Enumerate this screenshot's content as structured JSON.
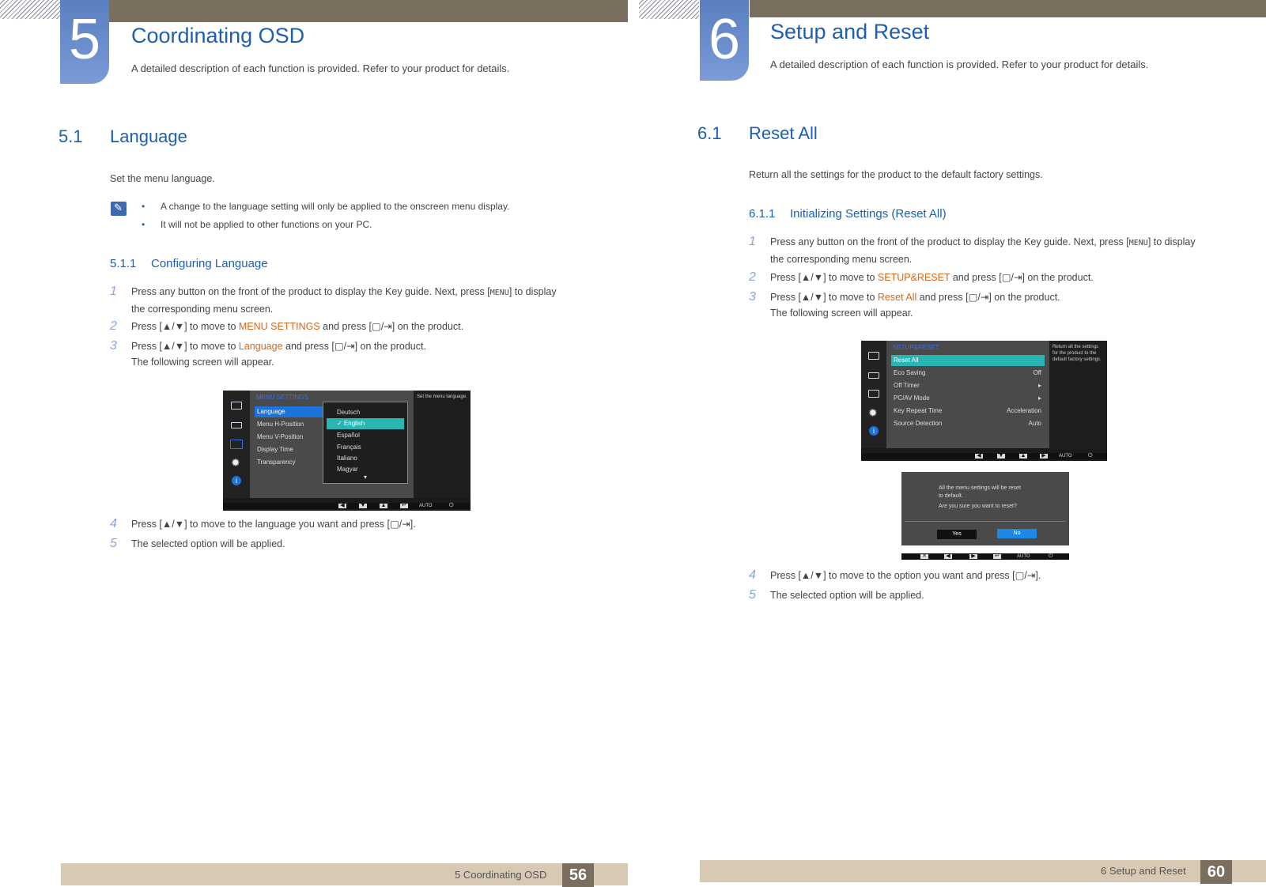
{
  "left": {
    "chapter_number": "5",
    "chapter_title": "Coordinating OSD",
    "chapter_desc": "A detailed description of each function is provided. Refer to your product for details.",
    "section_num": "5.1",
    "section_title": "Language",
    "intro": "Set the menu language.",
    "notes": [
      "A change to the language setting will only be applied to the onscreen menu display.",
      "It will not be applied to other functions on your PC."
    ],
    "subsection_num": "5.1.1",
    "subsection_title": "Configuring Language",
    "steps": [
      {
        "num": "1",
        "pre": "Press any button on the front of the product to display the Key guide. Next, press [",
        "key": "MENU",
        "post": "] to display",
        "line2": "the corresponding menu screen."
      },
      {
        "num": "2",
        "pre": "Press [▲/▼] to move to ",
        "hl": "MENU SETTINGS",
        "post": " and press [▢/⇥] on the product."
      },
      {
        "num": "3",
        "pre": "Press [▲/▼] to move to ",
        "hl": "Language",
        "post": " and press [▢/⇥] on the product.",
        "line2": "The following screen will appear."
      },
      {
        "num": "4",
        "text": "Press [▲/▼] to move to the language you want and press [▢/⇥]."
      },
      {
        "num": "5",
        "text": "The selected option will be applied."
      }
    ],
    "osd": {
      "title": "MENU SETTINGS",
      "items": [
        "Language",
        "Menu H-Position",
        "Menu V-Position",
        "Display Time",
        "Transparency"
      ],
      "languages": [
        "Deutsch",
        "English",
        "Español",
        "Français",
        "Italiano",
        "Magyar"
      ],
      "selected_language": "English",
      "help": "Set the menu language.",
      "more": "▾",
      "bottom_auto": "AUTO"
    },
    "footer_label": "5 Coordinating OSD",
    "page_number": "56"
  },
  "right": {
    "chapter_number": "6",
    "chapter_title": "Setup and Reset",
    "chapter_desc": "A detailed description of each function is provided. Refer to your product for details.",
    "section_num": "6.1",
    "section_title": "Reset All",
    "intro": "Return all the settings for the product to the default factory settings.",
    "subsection_num": "6.1.1",
    "subsection_title": "Initializing Settings (Reset All)",
    "steps": [
      {
        "num": "1",
        "pre": "Press any button on the front of the product to display the Key guide. Next, press [",
        "key": "MENU",
        "post": "] to display",
        "line2": "the corresponding menu screen."
      },
      {
        "num": "2",
        "pre": "Press [▲/▼] to move to ",
        "hl": "SETUP&RESET",
        "post": " and press [▢/⇥] on the product."
      },
      {
        "num": "3",
        "pre": "Press [▲/▼] to move to ",
        "hl": "Reset All",
        "post": " and press [▢/⇥] on the product.",
        "line2": "The following screen will appear."
      },
      {
        "num": "4",
        "text": "Press [▲/▼] to move to the option you want and press [▢/⇥]."
      },
      {
        "num": "5",
        "text": "The selected option will be applied."
      }
    ],
    "osd": {
      "title": "SETUP&RESET",
      "items": [
        {
          "label": "Reset All",
          "value": ""
        },
        {
          "label": "Eco Saving",
          "value": "Off"
        },
        {
          "label": "Off Timer",
          "value": "▸"
        },
        {
          "label": "PC/AV Mode",
          "value": "▸"
        },
        {
          "label": "Key Repeat Time",
          "value": "Acceleration"
        },
        {
          "label": "Source Detection",
          "value": "Auto"
        }
      ],
      "help": "Return all the settings for the product to the default factory settings.",
      "bottom_auto": "AUTO"
    },
    "dialog": {
      "line1": "All the menu settings will be reset",
      "line2": "to default.",
      "line3": "Are you sure you want to reset?",
      "yes": "Yes",
      "no": "No",
      "bottom_auto": "AUTO"
    },
    "footer_label": "6 Setup and Reset",
    "page_number": "60"
  }
}
